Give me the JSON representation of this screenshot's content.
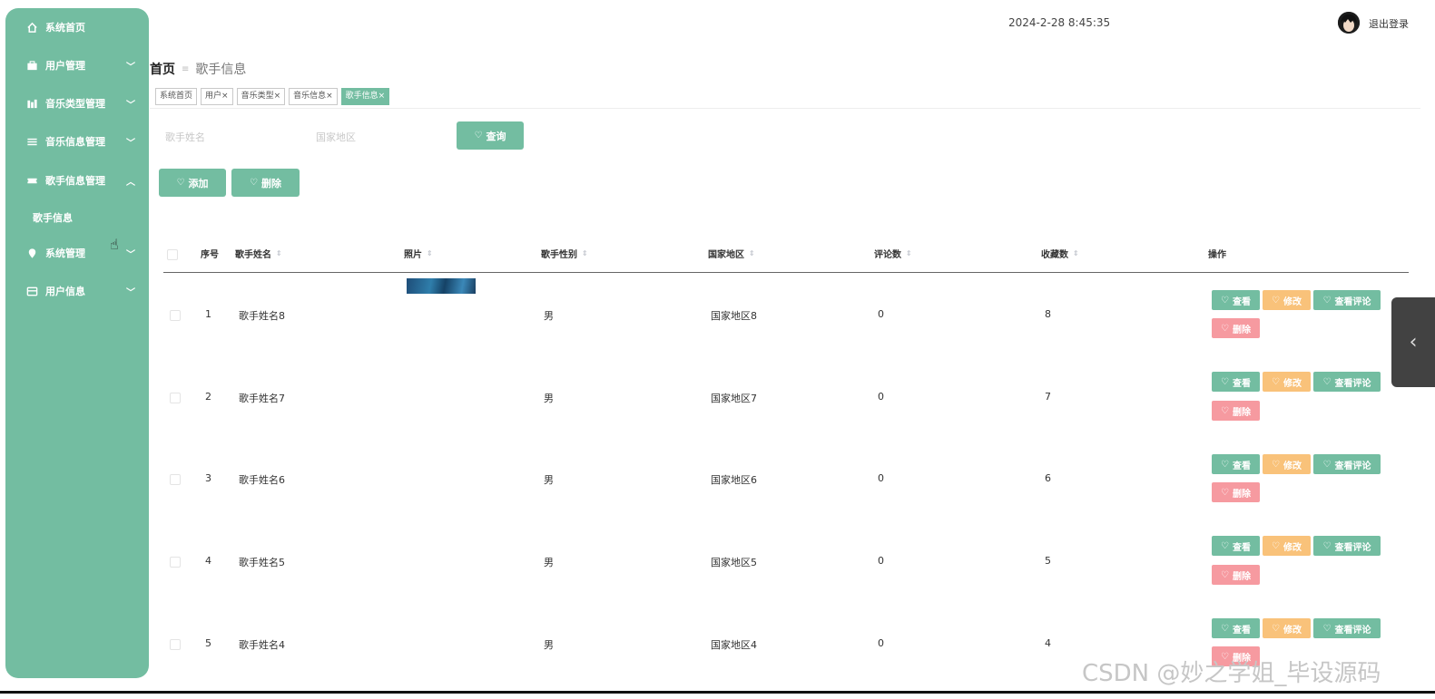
{
  "sidebar": {
    "items": [
      {
        "label": "系统首页",
        "icon": "home-icon",
        "arrow": ""
      },
      {
        "label": "用户管理",
        "icon": "briefcase-icon",
        "arrow": "﹀"
      },
      {
        "label": "音乐类型管理",
        "icon": "bar-icon",
        "arrow": "﹀"
      },
      {
        "label": "音乐信息管理",
        "icon": "list-icon",
        "arrow": "﹀"
      },
      {
        "label": "歌手信息管理",
        "icon": "ticket-icon",
        "arrow": "︿"
      },
      {
        "label": "系统管理",
        "icon": "location-icon",
        "arrow": "﹀"
      },
      {
        "label": "用户信息",
        "icon": "wallet-icon",
        "arrow": "﹀"
      }
    ],
    "submenu": [
      {
        "label": "歌手信息"
      }
    ]
  },
  "header": {
    "datetime": "2024-2-28 8:45:35",
    "logout": "退出登录"
  },
  "breadcrumb": {
    "home": "首页",
    "separator": "≡",
    "current": "歌手信息"
  },
  "tags": [
    {
      "label": "系统首页",
      "active": false
    },
    {
      "label": "用户×",
      "active": false
    },
    {
      "label": "音乐类型×",
      "active": false
    },
    {
      "label": "音乐信息×",
      "active": false
    },
    {
      "label": "歌手信息×",
      "active": true
    }
  ],
  "search": {
    "name_placeholder": "歌手姓名",
    "region_placeholder": "国家地区",
    "query_label": "查询"
  },
  "toolbar": {
    "add_label": "添加",
    "delete_label": "删除"
  },
  "table": {
    "columns": {
      "index": "序号",
      "name": "歌手姓名",
      "photo": "照片",
      "gender": "歌手性别",
      "region": "国家地区",
      "comments": "评论数",
      "favorites": "收藏数",
      "actions": "操作"
    },
    "sort_glyph": "⇕",
    "rows": [
      {
        "index": "1",
        "name": "歌手姓名8",
        "gender": "男",
        "region": "国家地区8",
        "comments": "0",
        "favorites": "8"
      },
      {
        "index": "2",
        "name": "歌手姓名7",
        "gender": "男",
        "region": "国家地区7",
        "comments": "0",
        "favorites": "7"
      },
      {
        "index": "3",
        "name": "歌手姓名6",
        "gender": "男",
        "region": "国家地区6",
        "comments": "0",
        "favorites": "6"
      },
      {
        "index": "4",
        "name": "歌手姓名5",
        "gender": "男",
        "region": "国家地区5",
        "comments": "0",
        "favorites": "5"
      },
      {
        "index": "5",
        "name": "歌手姓名4",
        "gender": "男",
        "region": "国家地区4",
        "comments": "0",
        "favorites": "4"
      }
    ],
    "actions": {
      "view": "查看",
      "edit": "修改",
      "comments": "查看评论",
      "delete": "删除"
    }
  },
  "watermark": "CSDN @妙之学姐_毕设源码",
  "colors": {
    "primary": "#73bda1",
    "warning": "#f9c27a",
    "danger": "#f69aa0"
  }
}
